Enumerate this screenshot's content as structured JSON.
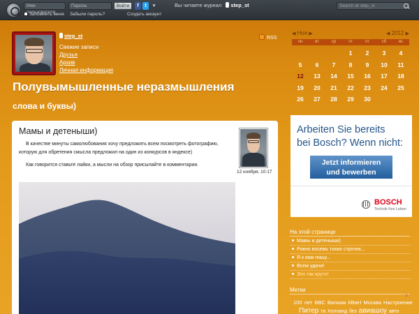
{
  "topbar": {
    "username_placeholder": "Имя пользователя",
    "password_placeholder": "Пароль",
    "login_button": "Войти",
    "remember_me": "Запомнить меня",
    "forgot_password": "Забыли пароль?",
    "create_account": "Создать аккаунт",
    "reading_label": "Вы читаете журнал",
    "journal_user": "step_st",
    "search_placeholder": "Search at step_st",
    "social": {
      "facebook": "f",
      "twitter": "t",
      "more": "▾"
    }
  },
  "header": {
    "username": "step_st",
    "nav": [
      "Свежие записи",
      "Друзья",
      "Архив",
      "Личная информация"
    ],
    "rss": "RSS",
    "title": "Полувымышленные неразмышления",
    "subtitle": "слова и буквы)"
  },
  "calendar": {
    "month": "Ноя",
    "year": "2012",
    "prev_arrow": "◀",
    "next_arrow": "▶",
    "weekdays": [
      "пн",
      "вт",
      "ср",
      "чт",
      "пт",
      "сб",
      "вс"
    ],
    "leading_blanks": 3,
    "days": [
      "1",
      "2",
      "3",
      "4",
      "5",
      "6",
      "7",
      "8",
      "9",
      "10",
      "11",
      "12",
      "13",
      "14",
      "15",
      "16",
      "17",
      "18",
      "19",
      "20",
      "21",
      "22",
      "23",
      "24",
      "25",
      "26",
      "27",
      "28",
      "29",
      "30"
    ],
    "today": "12"
  },
  "post": {
    "title": "Мамы и детеныши)",
    "paragraphs": [
      "В качестве минуты самолюбования хочу предложить всем посмотреть фотографию, которую для обретения смысла предложил на один из конкурсов в яндексе)",
      "Как говорится ставьте лайки, а мысли на обзор присылайте в комментарии."
    ],
    "date": "12 ноября, 10:17"
  },
  "ad": {
    "headline_line1": "Arbeiten Sie bereits",
    "headline_line2": "bei Bosch? Wenn nicht:",
    "button_line1": "Jetzt informieren",
    "button_line2": "und bewerben",
    "brand": "BOSCH",
    "tagline": "Technik fürs Leben"
  },
  "sidebar": {
    "on_page_heading": "На этой странице",
    "on_page_items": [
      "Мамы и детеныши)",
      "Ровно восемь тихих строчек...",
      "Я к вам пишу...",
      "Всем удачи!",
      "Это так круто!"
    ],
    "tags_heading": "Метки",
    "tags_close": "✕",
    "tags_row1": "100 лет BBC Валкам КВаН Москва Настроение",
    "tags_row2": [
      "Питер",
      "тв",
      "Холланд",
      "без",
      "авиашоу",
      "авто"
    ]
  },
  "colors": {
    "background_top": "#c97407",
    "background_bottom": "#e8a325",
    "topbar": "#2c3237",
    "calendar_header": "#b84b0a",
    "ad_button": "#235f9e",
    "bosch_red": "#e2001a"
  }
}
